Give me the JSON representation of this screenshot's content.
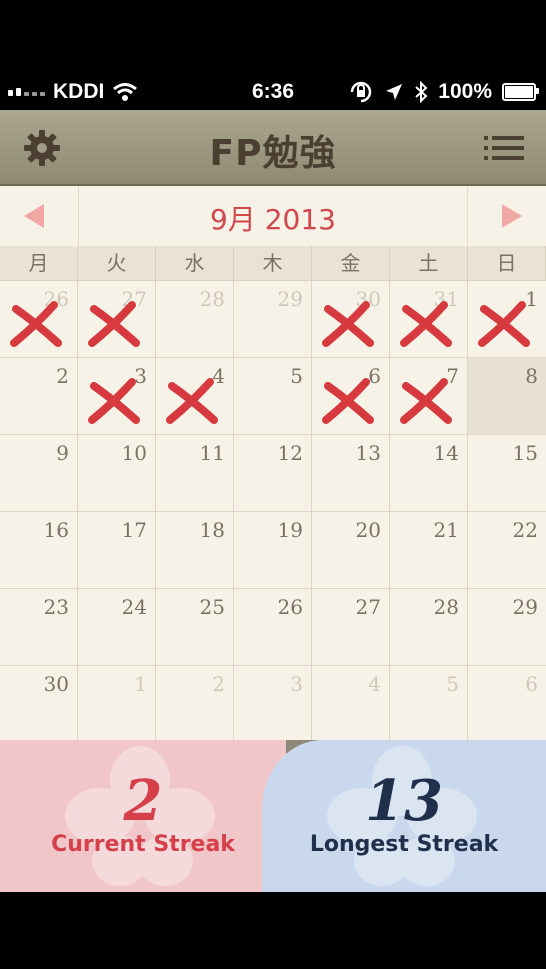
{
  "status_bar": {
    "carrier": "KDDI",
    "time": "6:36",
    "battery": "100%",
    "battery_level": 1.0
  },
  "navbar": {
    "title": "FP勉強",
    "settings_icon": "gear-icon",
    "menu_icon": "list-icon"
  },
  "calendar": {
    "month_label": "9月 2013",
    "prev_icon": "left-triangle-icon",
    "next_icon": "right-triangle-icon",
    "weekdays": [
      "月",
      "火",
      "水",
      "木",
      "金",
      "土",
      "日"
    ],
    "weeks": [
      [
        {
          "d": "26",
          "other": true,
          "x": true
        },
        {
          "d": "27",
          "other": true,
          "x": true
        },
        {
          "d": "28",
          "other": true,
          "x": false
        },
        {
          "d": "29",
          "other": true,
          "x": false
        },
        {
          "d": "30",
          "other": true,
          "x": true
        },
        {
          "d": "31",
          "other": true,
          "x": true
        },
        {
          "d": "1",
          "other": false,
          "x": true
        }
      ],
      [
        {
          "d": "2",
          "other": false,
          "x": false
        },
        {
          "d": "3",
          "other": false,
          "x": true
        },
        {
          "d": "4",
          "other": false,
          "x": true
        },
        {
          "d": "5",
          "other": false,
          "x": false
        },
        {
          "d": "6",
          "other": false,
          "x": true
        },
        {
          "d": "7",
          "other": false,
          "x": true
        },
        {
          "d": "8",
          "other": false,
          "x": false,
          "today": true
        }
      ],
      [
        {
          "d": "9"
        },
        {
          "d": "10"
        },
        {
          "d": "11"
        },
        {
          "d": "12"
        },
        {
          "d": "13"
        },
        {
          "d": "14"
        },
        {
          "d": "15"
        }
      ],
      [
        {
          "d": "16"
        },
        {
          "d": "17"
        },
        {
          "d": "18"
        },
        {
          "d": "19"
        },
        {
          "d": "20"
        },
        {
          "d": "21"
        },
        {
          "d": "22"
        }
      ],
      [
        {
          "d": "23"
        },
        {
          "d": "24"
        },
        {
          "d": "25"
        },
        {
          "d": "26"
        },
        {
          "d": "27"
        },
        {
          "d": "28"
        },
        {
          "d": "29"
        }
      ],
      [
        {
          "d": "30"
        },
        {
          "d": "1",
          "other": true
        },
        {
          "d": "2",
          "other": true
        },
        {
          "d": "3",
          "other": true
        },
        {
          "d": "4",
          "other": true
        },
        {
          "d": "5",
          "other": true
        },
        {
          "d": "6",
          "other": true
        }
      ]
    ],
    "mark_icon": "x-mark-icon",
    "mark_color": "#d63a3f"
  },
  "streaks": {
    "current": {
      "value": "2",
      "label": "Current Streak",
      "color": "#d5404a"
    },
    "longest": {
      "value": "13",
      "label": "Longest Streak",
      "color": "#1f2f4c"
    }
  }
}
